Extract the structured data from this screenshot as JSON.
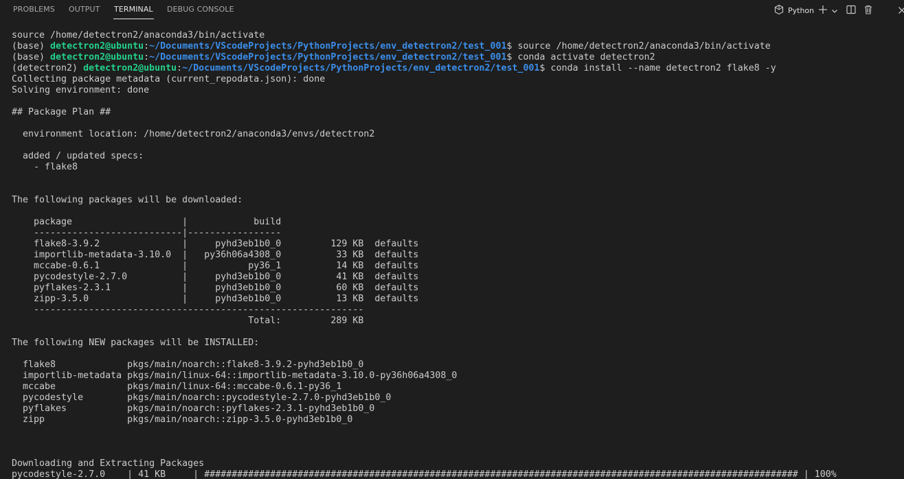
{
  "panel": {
    "tabs": [
      {
        "label": "PROBLEMS"
      },
      {
        "label": "OUTPUT"
      },
      {
        "label": "TERMINAL"
      },
      {
        "label": "DEBUG CONSOLE"
      }
    ],
    "active_tab": "TERMINAL",
    "terminal_kind": {
      "label": "Python",
      "icon": "python-icon"
    },
    "actions": [
      {
        "icon": "plus-icon",
        "name": "new-terminal"
      },
      {
        "icon": "chevron-down-icon",
        "name": "terminal-dropdown"
      },
      {
        "icon": "split-icon",
        "name": "split-terminal"
      },
      {
        "icon": "trash-icon",
        "name": "kill-terminal"
      },
      {
        "icon": "close-icon",
        "name": "close-panel"
      }
    ]
  },
  "colors": {
    "background": "#1e1e1e",
    "text": "#cccccc",
    "prompt_user": "#23d18b",
    "prompt_path": "#3b8eea",
    "active_tab": "#e7e7e7",
    "inactive_tab": "#a9a9a9"
  },
  "terminal": {
    "lines": [
      [
        {
          "t": "source /home/detectron2/anaconda3/bin/activate"
        }
      ],
      [
        {
          "t": "(base) "
        },
        {
          "t": "detectron2@ubuntu",
          "c": "user"
        },
        {
          "t": ":"
        },
        {
          "t": "~/Documents/VScodeProjects/PythonProjects/env_detectron2/test_001",
          "c": "path"
        },
        {
          "t": "$ source /home/detectron2/anaconda3/bin/activate"
        }
      ],
      [
        {
          "t": "(base) "
        },
        {
          "t": "detectron2@ubuntu",
          "c": "user"
        },
        {
          "t": ":"
        },
        {
          "t": "~/Documents/VScodeProjects/PythonProjects/env_detectron2/test_001",
          "c": "path"
        },
        {
          "t": "$ conda activate detectron2"
        }
      ],
      [
        {
          "t": "(detectron2) "
        },
        {
          "t": "detectron2@ubuntu",
          "c": "user"
        },
        {
          "t": ":"
        },
        {
          "t": "~/Documents/VScodeProjects/PythonProjects/env_detectron2/test_001",
          "c": "path"
        },
        {
          "t": "$ conda install --name detectron2 flake8 -y"
        }
      ],
      [
        {
          "t": "Collecting package metadata (current_repodata.json): done"
        }
      ],
      [
        {
          "t": "Solving environment: done"
        }
      ],
      [
        {
          "t": ""
        }
      ],
      [
        {
          "t": "## Package Plan ##"
        }
      ],
      [
        {
          "t": ""
        }
      ],
      [
        {
          "t": "  environment location: /home/detectron2/anaconda3/envs/detectron2"
        }
      ],
      [
        {
          "t": ""
        }
      ],
      [
        {
          "t": "  added / updated specs:"
        }
      ],
      [
        {
          "t": "    - flake8"
        }
      ],
      [
        {
          "t": ""
        }
      ],
      [
        {
          "t": ""
        }
      ],
      [
        {
          "t": "The following packages will be downloaded:"
        }
      ],
      [
        {
          "t": ""
        }
      ],
      [
        {
          "t": "    package                    |            build"
        }
      ],
      [
        {
          "t": "    ---------------------------|-----------------"
        }
      ],
      [
        {
          "t": "    flake8-3.9.2               |     pyhd3eb1b0_0         129 KB  defaults"
        }
      ],
      [
        {
          "t": "    importlib-metadata-3.10.0  |   py36h06a4308_0          33 KB  defaults"
        }
      ],
      [
        {
          "t": "    mccabe-0.6.1               |           py36_1          14 KB  defaults"
        }
      ],
      [
        {
          "t": "    pycodestyle-2.7.0          |     pyhd3eb1b0_0          41 KB  defaults"
        }
      ],
      [
        {
          "t": "    pyflakes-2.3.1             |     pyhd3eb1b0_0          60 KB  defaults"
        }
      ],
      [
        {
          "t": "    zipp-3.5.0                 |     pyhd3eb1b0_0          13 KB  defaults"
        }
      ],
      [
        {
          "t": "    ------------------------------------------------------------"
        }
      ],
      [
        {
          "t": "                                           Total:         289 KB"
        }
      ],
      [
        {
          "t": ""
        }
      ],
      [
        {
          "t": "The following NEW packages will be INSTALLED:"
        }
      ],
      [
        {
          "t": ""
        }
      ],
      [
        {
          "t": "  flake8             pkgs/main/noarch::flake8-3.9.2-pyhd3eb1b0_0"
        }
      ],
      [
        {
          "t": "  importlib-metadata pkgs/main/linux-64::importlib-metadata-3.10.0-py36h06a4308_0"
        }
      ],
      [
        {
          "t": "  mccabe             pkgs/main/linux-64::mccabe-0.6.1-py36_1"
        }
      ],
      [
        {
          "t": "  pycodestyle        pkgs/main/noarch::pycodestyle-2.7.0-pyhd3eb1b0_0"
        }
      ],
      [
        {
          "t": "  pyflakes           pkgs/main/noarch::pyflakes-2.3.1-pyhd3eb1b0_0"
        }
      ],
      [
        {
          "t": "  zipp               pkgs/main/noarch::zipp-3.5.0-pyhd3eb1b0_0"
        }
      ],
      [
        {
          "t": ""
        }
      ],
      [
        {
          "t": ""
        }
      ],
      [
        {
          "t": ""
        }
      ],
      [
        {
          "t": "Downloading and Extracting Packages"
        }
      ],
      [
        {
          "t": "pycodestyle-2.7.0    | 41 KB     | ############################################################################################################ | 100%"
        }
      ]
    ]
  }
}
